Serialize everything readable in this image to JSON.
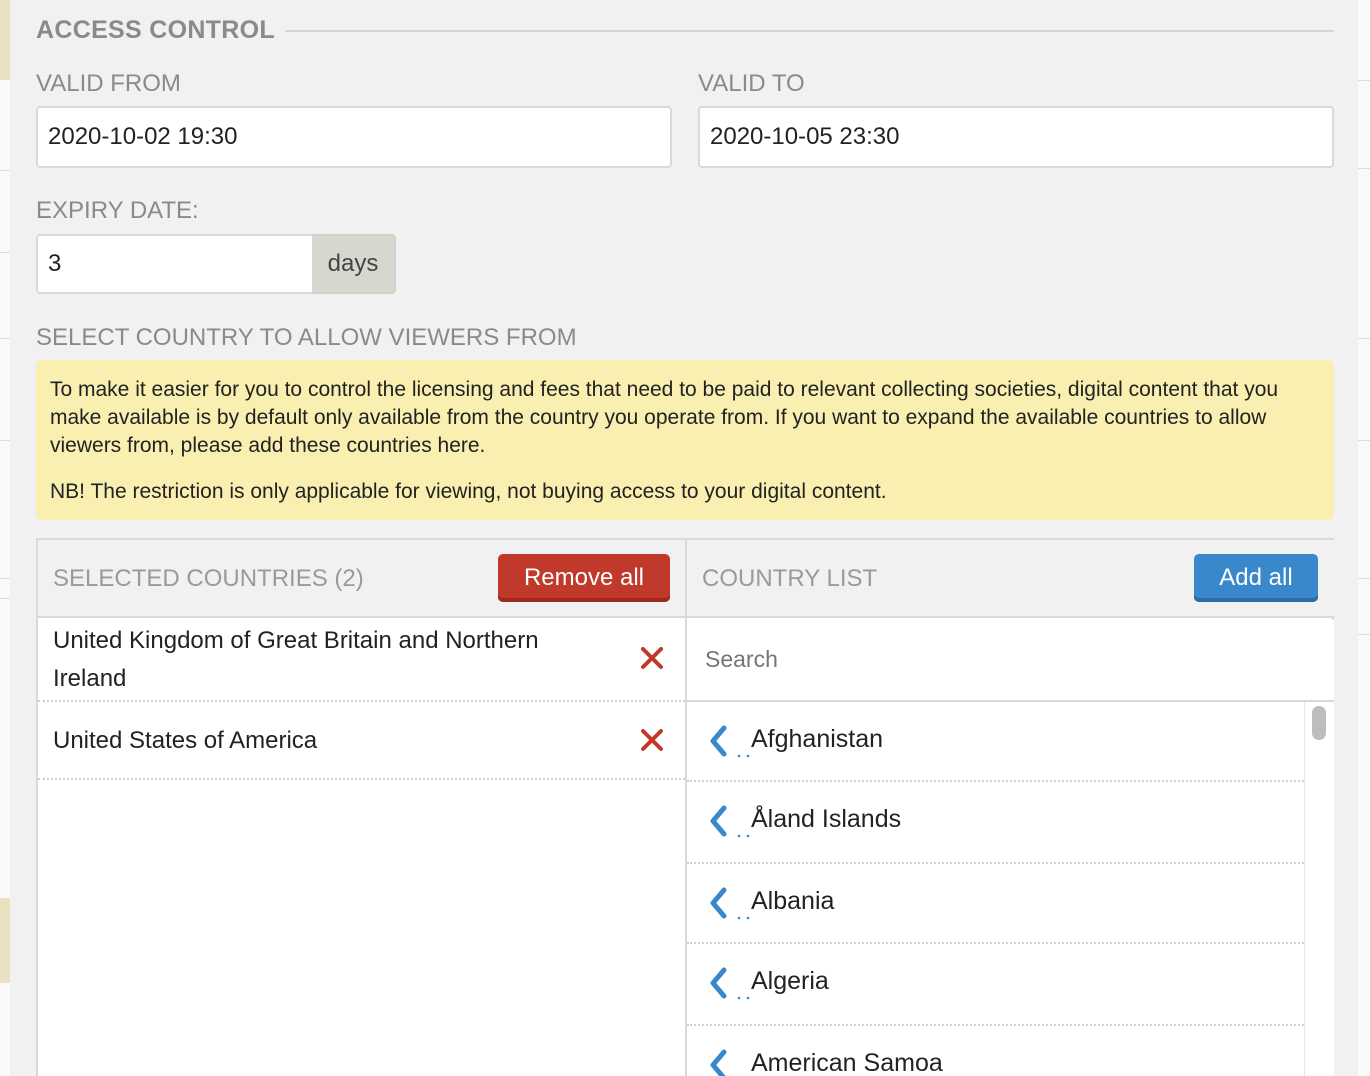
{
  "section": {
    "title": "ACCESS CONTROL"
  },
  "valid_from": {
    "label": "VALID FROM",
    "value": "2020-10-02 19:30"
  },
  "valid_to": {
    "label": "VALID TO",
    "value": "2020-10-05 23:30"
  },
  "expiry": {
    "label": "EXPIRY DATE:",
    "value": "3",
    "unit": "days"
  },
  "country_select": {
    "label": "SELECT COUNTRY TO ALLOW VIEWERS FROM",
    "notice": "To make it easier for you to control the licensing and fees that need to be paid to relevant collecting societies, digital content that you make available is by default only available from the country you operate from. If you want to expand the available countries to allow viewers from, please add these countries here.",
    "notice_nb": "NB! The restriction is only applicable for viewing, not buying access to your digital content."
  },
  "selected": {
    "title": "SELECTED COUNTRIES (2)",
    "remove_all_label": "Remove all",
    "items": [
      {
        "name": "United Kingdom of Great Britain and Northern Ireland"
      },
      {
        "name": "United States of America"
      }
    ]
  },
  "country_list": {
    "title": "COUNTRY LIST",
    "add_all_label": "Add all",
    "search_placeholder": "Search",
    "items": [
      {
        "name": "Afghanistan"
      },
      {
        "name": "Åland Islands"
      },
      {
        "name": "Albania"
      },
      {
        "name": "Algeria"
      },
      {
        "name": "American Samoa"
      }
    ]
  },
  "colors": {
    "remove": "#c0392b",
    "add": "#3a88cc",
    "notice_bg": "#f8efb1",
    "chevron": "#3a88cc"
  },
  "icons": {
    "remove": "close-icon",
    "add": "chevron-left-icon"
  }
}
